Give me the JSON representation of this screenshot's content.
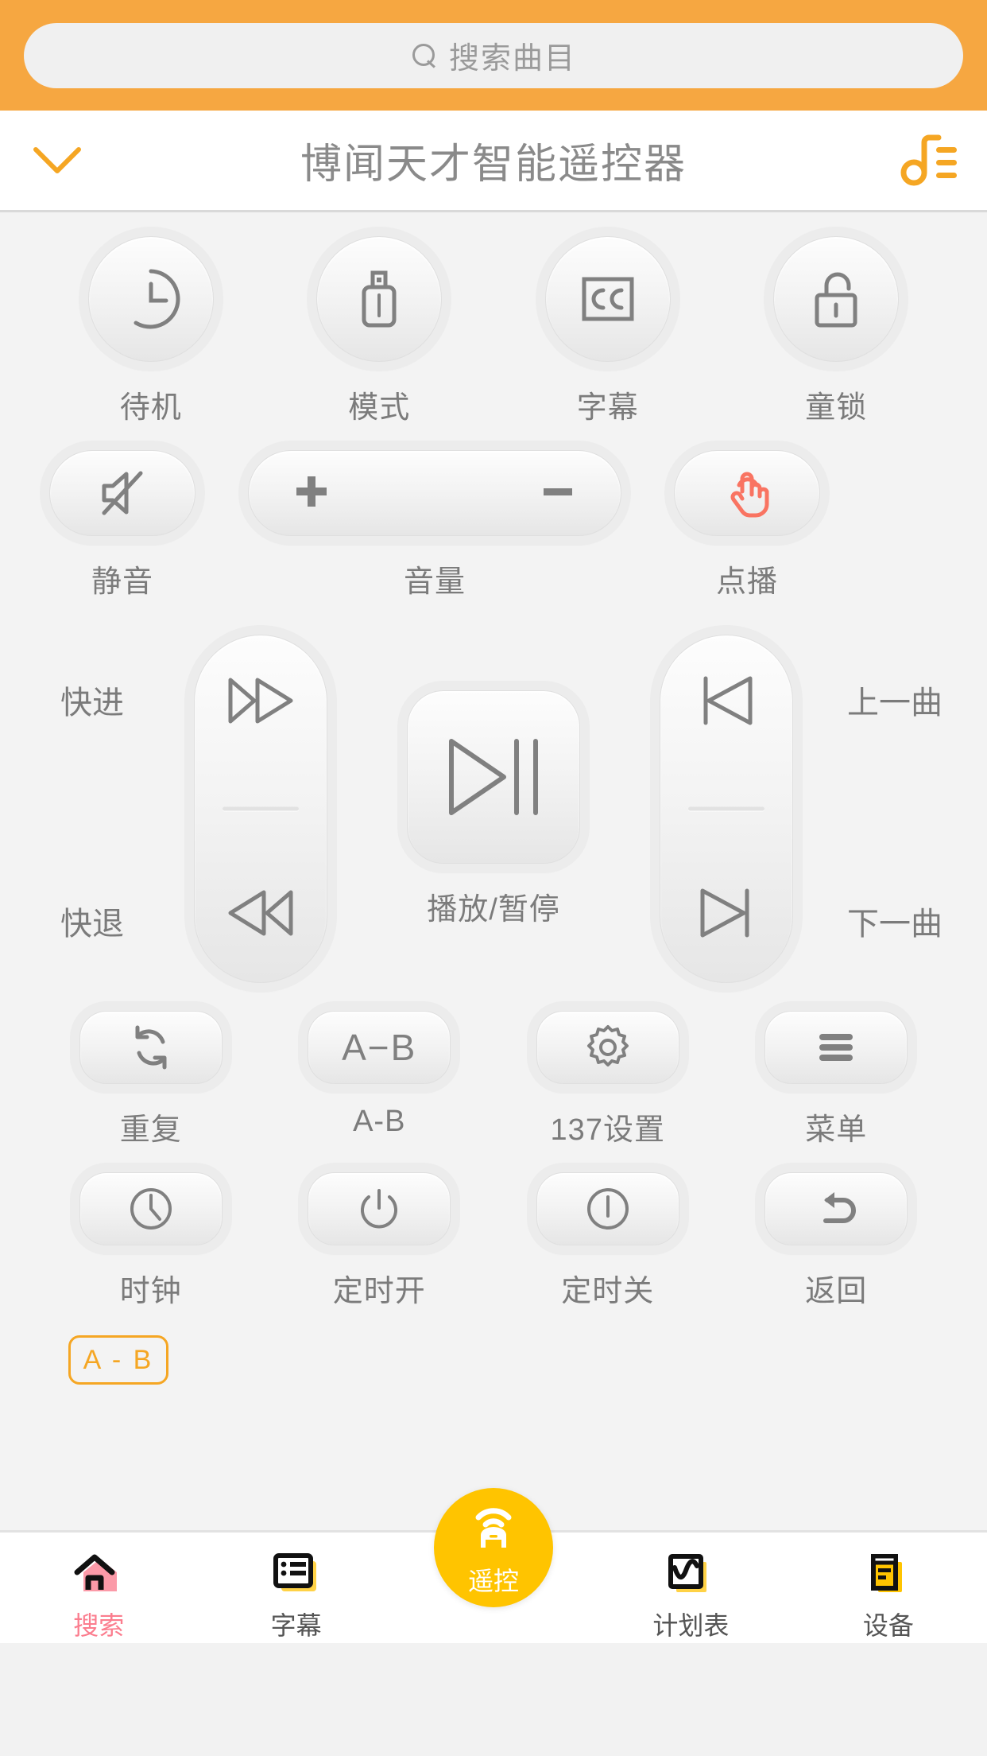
{
  "search": {
    "placeholder": "搜索曲目",
    "icon": "search-icon"
  },
  "header": {
    "title": "博闻天才智能遥控器",
    "collapse_icon": "chevron-down-icon",
    "playlist_icon": "music-playlist-icon"
  },
  "colors": {
    "accent_orange": "#f6a741",
    "badge_orange": "#f5a623",
    "fab_yellow": "#ffc400",
    "home_pink": "#fb7d8e",
    "tap_coral": "#f97462",
    "icon_gray": "#808080",
    "label_gray": "#7b7b7b"
  },
  "remote": {
    "row1": [
      {
        "label": "待机",
        "icon": "standby-clock-icon"
      },
      {
        "label": "模式",
        "icon": "usb-drive-icon"
      },
      {
        "label": "字幕",
        "icon": "cc-subtitle-icon"
      },
      {
        "label": "童锁",
        "icon": "lock-open-icon"
      }
    ],
    "row2": {
      "mute": {
        "label": "静音",
        "icon": "mute-speaker-icon"
      },
      "volume": {
        "label": "音量",
        "plus": "+",
        "minus": "−",
        "icon_plus": "plus-icon",
        "icon_minus": "minus-icon"
      },
      "demand": {
        "label": "点播",
        "icon": "tap-hand-icon"
      }
    },
    "transport": {
      "left_top_label": "快进",
      "left_bottom_label": "快退",
      "right_top_label": "上一曲",
      "right_bottom_label": "下一曲",
      "center_label": "播放/暂停",
      "icons": {
        "fast_forward": "fast-forward-icon",
        "fast_rewind": "fast-rewind-icon",
        "previous_track": "previous-track-icon",
        "next_track": "next-track-icon",
        "play_pause": "play-pause-icon"
      }
    },
    "row4": [
      {
        "label": "重复",
        "icon": "repeat-icon",
        "glyph": ""
      },
      {
        "label": "A-B",
        "icon": "a-b-icon",
        "glyph": "A−B"
      },
      {
        "label": "137设置",
        "icon": "gear-icon",
        "glyph": ""
      },
      {
        "label": "菜单",
        "icon": "menu-hamburger-icon",
        "glyph": ""
      }
    ],
    "row5": [
      {
        "label": "时钟",
        "icon": "clock-icon"
      },
      {
        "label": "定时开",
        "icon": "power-on-timer-icon"
      },
      {
        "label": "定时关",
        "icon": "power-off-timer-icon"
      },
      {
        "label": "返回",
        "icon": "back-arrow-icon"
      }
    ],
    "ab_badge": {
      "text": "A - B"
    }
  },
  "bottom_nav": [
    {
      "label": "搜索",
      "icon": "home-icon",
      "active": false
    },
    {
      "label": "字幕",
      "icon": "subtitle-list-icon",
      "active": false
    },
    {
      "label": "遥控",
      "icon": "remote-control-icon",
      "active": true
    },
    {
      "label": "计划表",
      "icon": "schedule-chart-icon",
      "active": false
    },
    {
      "label": "设备",
      "icon": "device-book-icon",
      "active": false
    }
  ]
}
